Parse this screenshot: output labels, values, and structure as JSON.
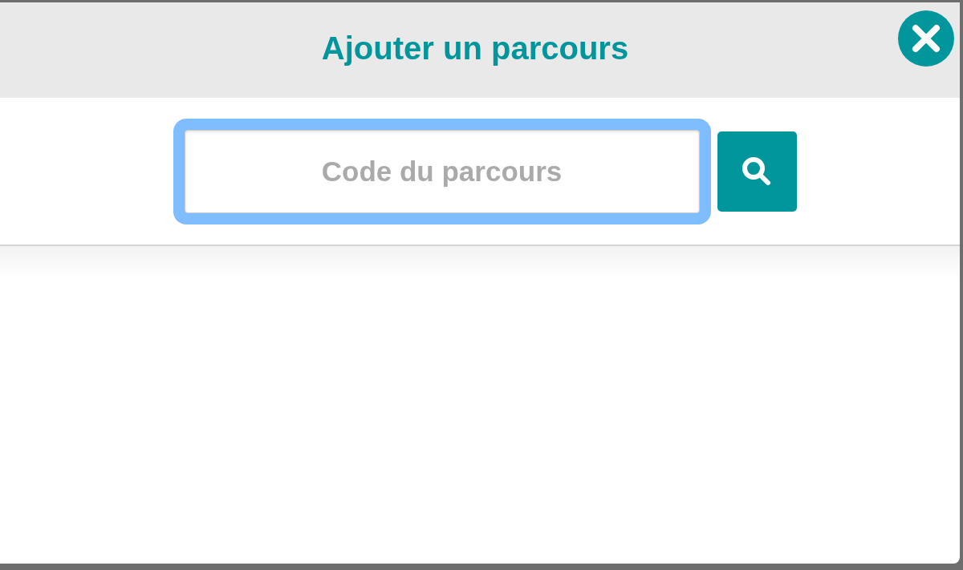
{
  "dialog": {
    "title": "Ajouter un parcours"
  },
  "search": {
    "placeholder": "Code du parcours",
    "focused": true
  }
}
